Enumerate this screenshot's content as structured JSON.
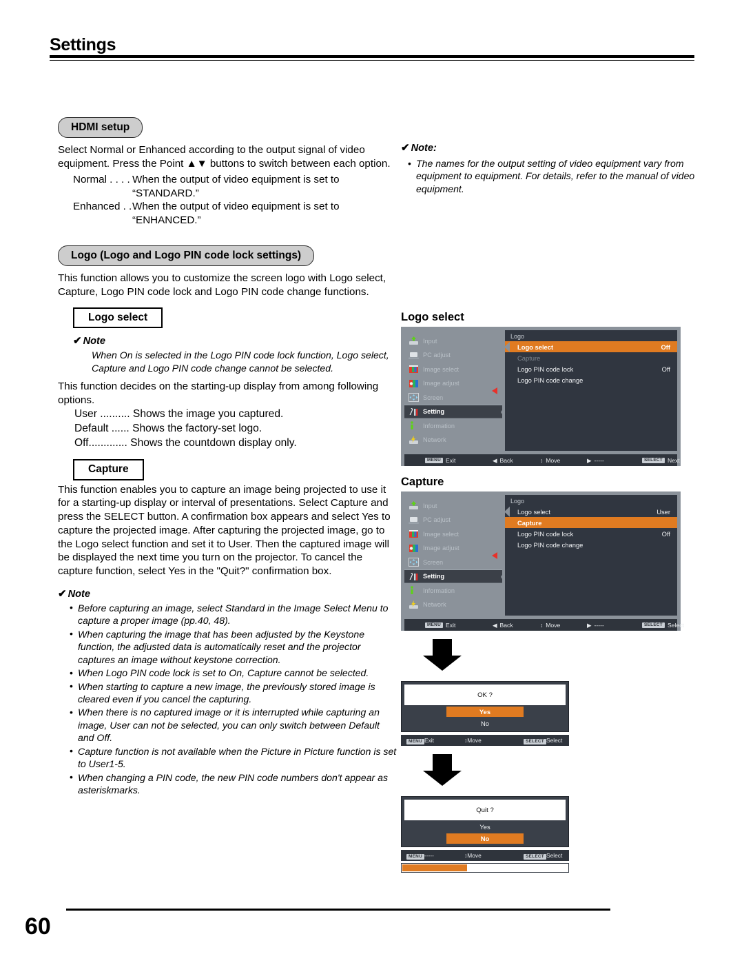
{
  "page": {
    "header_title": "Settings",
    "page_number": "60"
  },
  "hdmi": {
    "heading": "HDMI setup",
    "intro": "Select Normal or Enhanced according to the output signal of video equipment. Press the Point ▲▼ buttons to switch between each option.",
    "definitions": [
      {
        "term": "Normal . . . .",
        "desc": "When the output of video equipment is set to “STANDARD.”"
      },
      {
        "term": "Enhanced . .",
        "desc": "When the output of video equipment is set to “ENHANCED.”"
      }
    ],
    "note": {
      "check": "✔",
      "title": "Note:",
      "bullets": [
        "The names for the output setting of video equipment vary from equipment to equipment. For details, refer to the manual of video equipment."
      ]
    }
  },
  "logo": {
    "heading": "Logo (Logo and Logo PIN code lock settings)",
    "intro": "This function allows you to customize the screen logo with Logo select, Capture, Logo PIN code lock and Logo PIN code change functions.",
    "logo_select": {
      "box_heading": "Logo select",
      "note_check": "✔",
      "note_title": "Note",
      "note_text": "When On is selected in the Logo PIN code lock function, Logo select, Capture and Logo PIN code change cannot be selected.",
      "intro": "This function decides on the starting-up display from among following options.",
      "options": [
        "User .......... Shows the image you captured.",
        "Default ...... Shows the factory-set logo.",
        "Off............. Shows the countdown display only."
      ]
    },
    "capture": {
      "box_heading": "Capture",
      "intro": "This function enables you to capture an image being projected to use it for a starting-up display or interval of presentations. Select Capture and press the SELECT button.  A confirmation box appears and select Yes to capture the projected image. After capturing the projected image, go to the Logo select function and set it to User. Then the captured image will be displayed the next time you turn on the projector. To cancel the capture function, select Yes in the \"Quit?\" confirmation box.",
      "note_check": "✔",
      "note_title": "Note",
      "note_bullets": [
        "Before capturing an image, select Standard in the Image Select Menu to capture a proper image (pp.40, 48).",
        "When capturing the image that has been adjusted by the Keystone function, the adjusted data is automatically reset and the projector captures an image without keystone correction.",
        "When Logo PIN code lock is set to On, Capture cannot be selected.",
        "When starting to capture a new image, the previously stored image is cleared even if you cancel the capturing.",
        "When there is no captured image or it is interrupted while capturing an image, User can not be selected, you can only switch between Default and Off.",
        "Capture function is not available when the Picture in Picture function is set to User1-5.",
        "When changing a PIN code, the new PIN code numbers don't appear as asteriskmarks."
      ]
    }
  },
  "osd_sidebar": [
    {
      "label": "Input",
      "icon": "input-icon",
      "state": "dim"
    },
    {
      "label": "PC adjust",
      "icon": "pc-adjust-icon",
      "state": "dim"
    },
    {
      "label": "Image select",
      "icon": "image-select-icon",
      "state": "dim"
    },
    {
      "label": "Image adjust",
      "icon": "image-adjust-icon",
      "state": "dim"
    },
    {
      "label": "Screen",
      "icon": "screen-icon",
      "state": "dim"
    },
    {
      "label": "Setting",
      "icon": "setting-icon",
      "state": "active"
    },
    {
      "label": "Information",
      "icon": "information-icon",
      "state": "dim"
    },
    {
      "label": "Network",
      "icon": "network-icon",
      "state": "dim"
    }
  ],
  "osd_logo_select": {
    "caption": "Logo select",
    "panel_title": "Logo",
    "rows": [
      {
        "label": "Logo select",
        "value": "Off",
        "state": "selected"
      },
      {
        "label": "Capture",
        "value": "",
        "state": "disabled"
      },
      {
        "label": "Logo PIN code lock",
        "value": "Off",
        "state": "normal"
      },
      {
        "label": "Logo PIN code change",
        "value": "",
        "state": "normal"
      }
    ],
    "bar": [
      {
        "key": "MENU",
        "label": "Exit"
      },
      {
        "key": "◀",
        "label": "Back"
      },
      {
        "key": "↕",
        "label": "Move"
      },
      {
        "key": "▶",
        "label": "-----"
      },
      {
        "key": "SELECT",
        "label": "Next"
      }
    ]
  },
  "osd_capture": {
    "caption": "Capture",
    "panel_title": "Logo",
    "rows": [
      {
        "label": "Logo select",
        "value": "User",
        "state": "normal"
      },
      {
        "label": "Capture",
        "value": "",
        "state": "selected"
      },
      {
        "label": "Logo PIN code lock",
        "value": "Off",
        "state": "normal"
      },
      {
        "label": "Logo PIN code change",
        "value": "",
        "state": "normal"
      }
    ],
    "bar": [
      {
        "key": "MENU",
        "label": "Exit"
      },
      {
        "key": "◀",
        "label": "Back"
      },
      {
        "key": "↕",
        "label": "Move"
      },
      {
        "key": "▶",
        "label": "-----"
      },
      {
        "key": "SELECT",
        "label": "Select"
      }
    ]
  },
  "dialog_ok": {
    "question": "OK ?",
    "options": [
      {
        "label": "Yes",
        "state": "selected"
      },
      {
        "label": "No",
        "state": "normal"
      }
    ],
    "bar": [
      {
        "key": "MENU",
        "label": "Exit"
      },
      {
        "key": "↕",
        "label": "Move"
      },
      {
        "key": "SELECT",
        "label": "Select"
      }
    ]
  },
  "dialog_quit": {
    "question": "Quit ?",
    "options": [
      {
        "label": "Yes",
        "state": "normal"
      },
      {
        "label": "No",
        "state": "selected"
      }
    ],
    "bar": [
      {
        "key": "MENU",
        "label": "-----"
      },
      {
        "key": "↕",
        "label": "Move"
      },
      {
        "key": "SELECT",
        "label": "Select"
      }
    ],
    "progress_percent": 39
  },
  "colors": {
    "accent_orange": "#e07b21",
    "osd_panel": "#303640",
    "osd_sidebar": "#8b929a",
    "osd_bar": "#2f343c",
    "pill_fill": "#cdcdcd"
  }
}
